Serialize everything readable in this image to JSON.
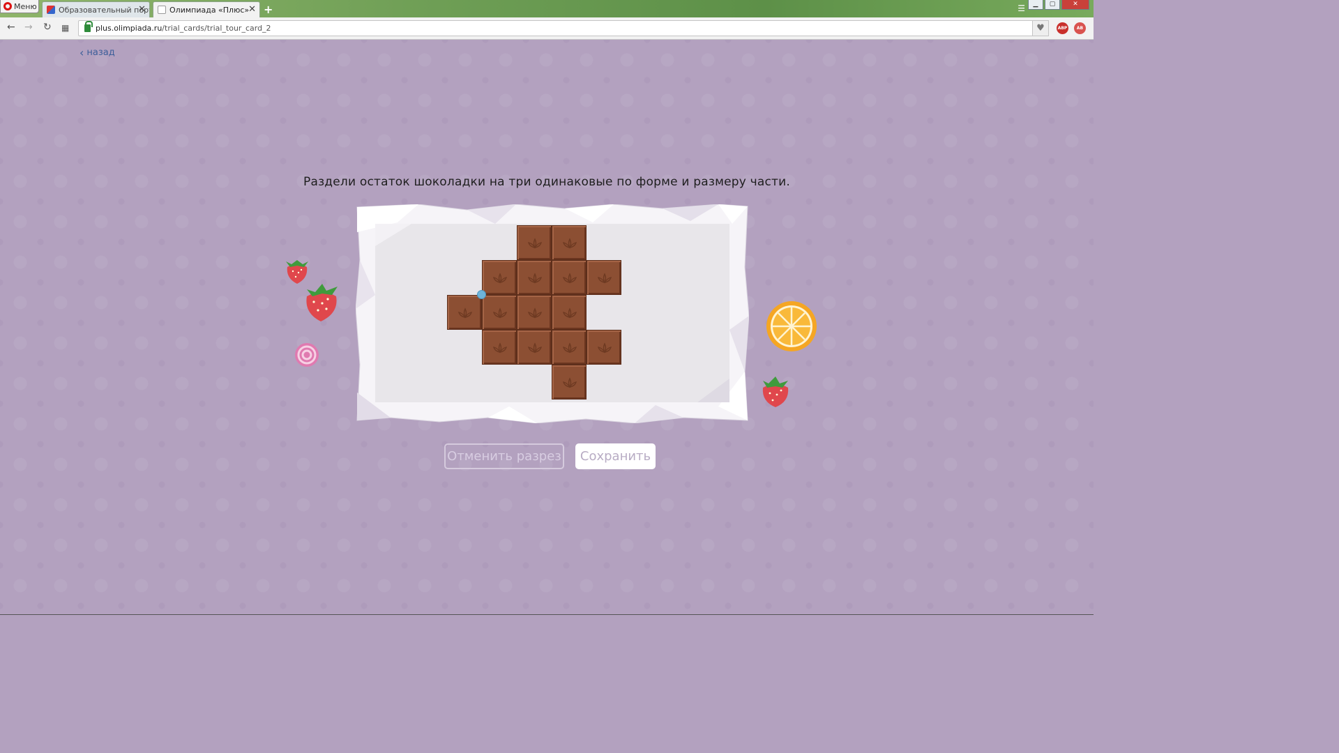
{
  "browser": {
    "menu_label": "Меню",
    "tabs": [
      {
        "label": "Образовательный портал",
        "active": false
      },
      {
        "label": "Олимпиада «Плюс»",
        "active": true
      }
    ],
    "new_tab_label": "+",
    "url_host": "plus.olimpiada.ru",
    "url_path": "/trial_cards/trial_tour_card_2",
    "extensions": [
      "ABP",
      "AB"
    ]
  },
  "page": {
    "back_label": "назад",
    "task_text": "Раздели остаток шоколадки на три одинаковые по форме и размеру части.",
    "cancel_cut_label": "Отменить разрез",
    "save_label": "Сохранить"
  },
  "chocolate": {
    "rows": [
      [
        0,
        0,
        1,
        1,
        0
      ],
      [
        0,
        1,
        1,
        1,
        1
      ],
      [
        1,
        1,
        1,
        1,
        0
      ],
      [
        0,
        1,
        1,
        1,
        1
      ],
      [
        0,
        0,
        0,
        1,
        0
      ]
    ]
  },
  "colors": {
    "background": "#b3a1bf",
    "chocolate": "#8c4f33",
    "cut_marker": "#6db4da",
    "back_link": "#3d5f9a"
  },
  "icons": [
    "back-chevron-icon",
    "strawberry-icon",
    "candy-icon",
    "orange-slice-icon",
    "heart-icon",
    "lock-icon"
  ]
}
